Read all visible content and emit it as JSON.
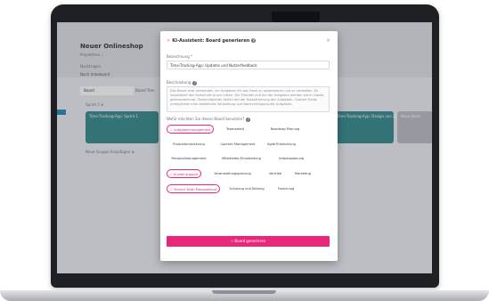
{
  "background_app": {
    "title": "Neuer Onlineshop",
    "subtitle": "Projektfase ⌄",
    "meta_label": "Nachtragen",
    "meta_value": "Nach Unbekannt",
    "tabs": [
      "Board",
      "Board Tran"
    ],
    "lane_label": "Sprint 2 ⊕",
    "cards": [
      "Time-Tracking-App: Sprint 1",
      "Time-Tracking-App: Design uns Zeiterfahrung",
      "Neue Karte"
    ],
    "footer_line": "Neue Gruppe hinzufügen ⊕"
  },
  "modal": {
    "title": "KI-Assistent: Board generieren",
    "close": "×",
    "name_label": "Bezeichnung *",
    "name_value": "Time-Tracking-App: Updates und Nutzerfeedback",
    "desc_label": "Beschreibung",
    "desc_value": "Das Board wird verwendet, um Aufgaben für das Team zu organisieren und zu verwalten. Es visualisiert den Fortschritt durch Listen. Die Priorität und Art der Aufgaben werden durch Labels gekennzeichnet. Teammitglieder helfen bei der Klassifizierung der Aufgaben. Custom Fields ermöglichen eine detaillierte Verwaltung und Nachverfolgung der Aufgaben.",
    "areas_label": "Wofür möchten Sie dieses Board benutzen?",
    "chips": [
      {
        "label": "Aufgabenmanagement",
        "selected": true
      },
      {
        "label": "Teamarbeit",
        "selected": false
      },
      {
        "label": "Roadmap Planung",
        "selected": false
      },
      {
        "label": "Produktentwicklung",
        "selected": false
      },
      {
        "label": "Content Management",
        "selected": false
      },
      {
        "label": "Agile Entwicklung",
        "selected": false
      },
      {
        "label": "Personalmanagement",
        "selected": false
      },
      {
        "label": "Mitarbeiter-Einarbeitung",
        "selected": false
      },
      {
        "label": "Urlaubsplanung",
        "selected": false
      },
      {
        "label": "Kundensupport",
        "selected": true
      },
      {
        "label": "Veranstaltungsplanung",
        "selected": false
      },
      {
        "label": "Vertrieb",
        "selected": false
      },
      {
        "label": "Marketing",
        "selected": false
      },
      {
        "label": "Service Desk Management",
        "selected": true
      },
      {
        "label": "Schulung und Bildung",
        "selected": false
      },
      {
        "label": "Forschung",
        "selected": false
      }
    ],
    "submit_label": "✧ Board generieren"
  },
  "colors": {
    "accent": "#e8267c",
    "card_teal": "#3e8d93",
    "laptop_bezel": "#1f2024"
  }
}
